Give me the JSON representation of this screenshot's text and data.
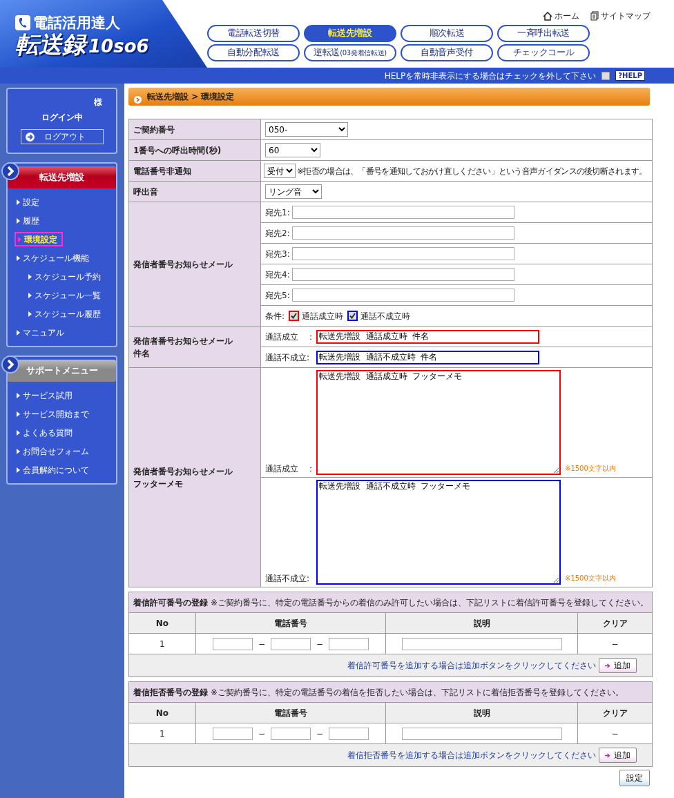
{
  "header": {
    "logo": {
      "tagline": "電話活用達人",
      "name": "転送録",
      "version": "10so6"
    },
    "links": [
      {
        "kind": "home",
        "label": "ホーム"
      },
      {
        "kind": "sitemap",
        "label": "サイトマップ"
      }
    ],
    "tabs": [
      {
        "label": "電話転送切替",
        "selected": false
      },
      {
        "label": "転送先増設",
        "selected": true
      },
      {
        "label": "順次転送",
        "selected": false
      },
      {
        "label": "一斉呼出転送",
        "selected": false
      },
      {
        "label": "自動分配転送",
        "selected": false
      },
      {
        "label": "逆転送",
        "sublabel": "(03発着信転送)",
        "selected": false
      },
      {
        "label": "自動音声受付",
        "selected": false
      },
      {
        "label": "チェックコール",
        "selected": false
      }
    ],
    "help_bar": {
      "text": "HELPを常時非表示にする場合はチェックを外して下さい",
      "checked": false,
      "button": "?HELP"
    }
  },
  "sidebar": {
    "user": {
      "suffix": "様",
      "status": "ログイン中",
      "logout": "ログアウト"
    },
    "menus": [
      {
        "kind": "service",
        "title": "転送先増設",
        "items": [
          {
            "label": "設定",
            "selected": false
          },
          {
            "label": "履歴",
            "selected": false
          },
          {
            "label": "環境設定",
            "selected": true
          },
          {
            "label": "スケジュール機能",
            "selected": false,
            "children": [
              {
                "label": "スケジュール予約",
                "selected": false
              },
              {
                "label": "スケジュール一覧",
                "selected": false
              },
              {
                "label": "スケジュール履歴",
                "selected": false
              }
            ]
          },
          {
            "label": "マニュアル",
            "selected": false
          }
        ]
      },
      {
        "kind": "support",
        "title": "サポートメニュー",
        "items": [
          {
            "label": "サービス試用",
            "selected": false
          },
          {
            "label": "サービス開始まで",
            "selected": false
          },
          {
            "label": "よくある質問",
            "selected": false
          },
          {
            "label": "お問合せフォーム",
            "selected": false
          },
          {
            "label": "会員解約について",
            "selected": false
          }
        ]
      }
    ]
  },
  "breadcrumb": "転送先増設 > 環境設定",
  "settings": {
    "contract_number": {
      "label": "ご契約番号",
      "value": "050-"
    },
    "ring_time": {
      "label": "1番号への呼出時間(秒)",
      "value": "60"
    },
    "withheld": {
      "label": "電話番号非通知",
      "value": "受付",
      "note": "※拒否の場合は、「番号を通知しておかけ直しください」という音声ガイダンスの後切断されます。"
    },
    "ringtone": {
      "label": "呼出音",
      "value": "リング音"
    },
    "notify_mail": {
      "label": "発信者番号お知らせメール",
      "addresses": [
        {
          "label": "宛先1:"
        },
        {
          "label": "宛先2:"
        },
        {
          "label": "宛先3:"
        },
        {
          "label": "宛先4:"
        },
        {
          "label": "宛先5:"
        }
      ],
      "conditions_label": "条件:",
      "conditions": [
        {
          "label": "通話成立時",
          "checked": true,
          "color": "#ff0000"
        },
        {
          "label": "通話不成立時",
          "checked": true,
          "color": "#0000ff"
        }
      ]
    },
    "subject": {
      "label_lines": [
        "発信者番号お知らせメール",
        "件名"
      ],
      "entries": [
        {
          "label": "通話成立　：",
          "value": "転送先増設  通話成立時  件名",
          "color": "#ff0000"
        },
        {
          "label": "通話不成立:",
          "value": "転送先増設  通話不成立時  件名",
          "color": "#0000ff"
        }
      ]
    },
    "footer": {
      "label_lines": [
        "発信者番号お知らせメール",
        "フッターメモ"
      ],
      "entries": [
        {
          "label": "通話成立　：",
          "value": "転送先増設  通話成立時  フッターメモ",
          "note": "※1500文字以内",
          "color": "#ff0000"
        },
        {
          "label": "通話不成立:",
          "value": "転送先増設  通話不成立時  フッターメモ",
          "note": "※1500文字以内",
          "color": "#0000ff"
        }
      ]
    }
  },
  "number_lists": [
    {
      "title": "着信許可番号の登録",
      "note": "※ご契約番号に、特定の電話番号からの着信のみ許可したい場合は、下記リストに着信許可番号を登録してください。",
      "columns": [
        "No",
        "電話番号",
        "説明",
        "クリア"
      ],
      "rows": [
        {
          "no": "1",
          "separators": [
            "−",
            "−"
          ],
          "clear": "−"
        }
      ],
      "add_hint": "着信許可番号を追加する場合は追加ボタンをクリックしてください",
      "add_button": "追加"
    },
    {
      "title": "着信拒否番号の登録",
      "note": "※ご契約番号に、特定の電話番号の着信を拒否したい場合は、下記リストに着信拒否番号を登録してください。",
      "columns": [
        "No",
        "電話番号",
        "説明",
        "クリア"
      ],
      "rows": [
        {
          "no": "1",
          "separators": [
            "−",
            "−"
          ],
          "clear": "−"
        }
      ],
      "add_hint": "着信拒否番号を追加する場合は追加ボタンをクリックしてください",
      "add_button": "追加"
    }
  ],
  "submit": "設定"
}
